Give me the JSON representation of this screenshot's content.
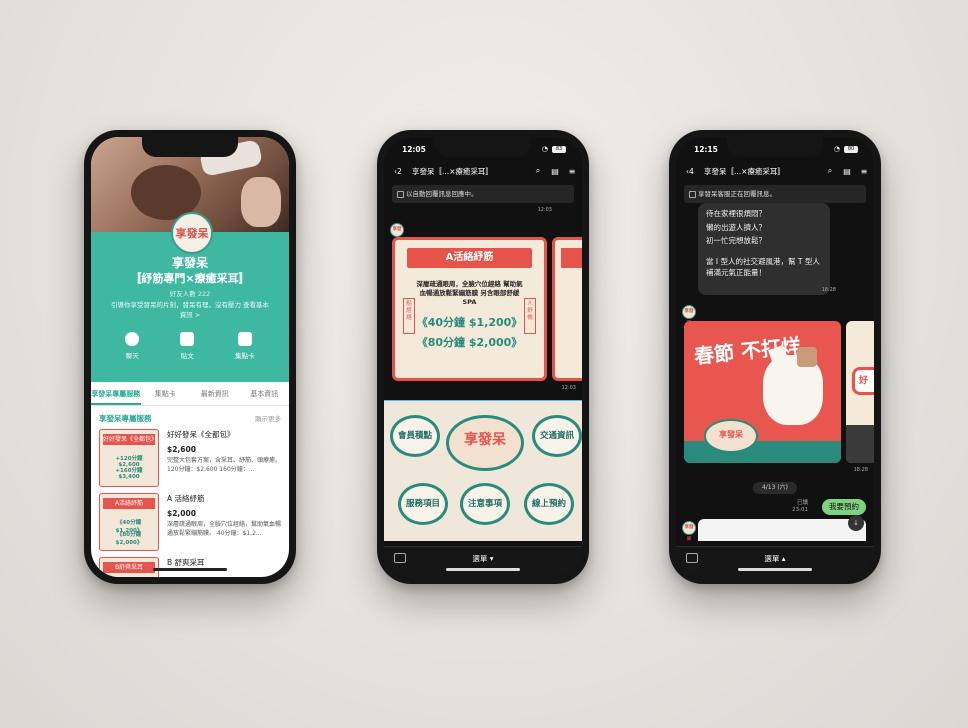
{
  "phone1": {
    "logo_text": "享發呆",
    "account_name": "享發呆",
    "subtitle": "〚紓筋專門×療癒采耳〛",
    "friends": "好友人數 222",
    "description": "引導你享受發呆的片刻，發呆有理，沒有壓力 查看基本資訊 >",
    "actions": [
      "聊天",
      "貼文",
      "集點卡"
    ],
    "tabs": [
      "享發呆專屬服務",
      "集點卡",
      "最新資訊",
      "基本資訊"
    ],
    "section_title": "享發呆專屬服務",
    "show_more": "顯示更多",
    "products": [
      {
        "thumb_title": "好好發呆《全都包》",
        "thumb_l1": "+120分鐘 $2,600",
        "thumb_l2": "+160分鐘 $3,400",
        "name": "好好發呆《全都包》",
        "price": "$2,600",
        "desc": "完整大包套方案，含采耳、紓筋、頭療癒。 120分鐘：$2,600 160分鐘：..."
      },
      {
        "thumb_title": "A活絡紓筋",
        "thumb_l1": "《40分鐘 $1,200》",
        "thumb_l2": "《80分鐘 $2,000》",
        "name": "A 活絡紓筋",
        "price": "$2,000",
        "desc": "深層疏通眼周，全臉穴位經絡，幫助氣血暢通放鬆緊繃筋膜。 40分鐘：$1,2..."
      },
      {
        "thumb_title": "B舒爽采耳",
        "thumb_l1": "",
        "thumb_l2": "",
        "name": "B 舒爽采耳",
        "price": "",
        "desc": ""
      }
    ]
  },
  "phone2": {
    "time": "12:05",
    "battery": "83",
    "back_count": "2",
    "title": "享發呆〚...×療癒采耳〛",
    "notice": "以自動回覆訊息回應中。",
    "card": {
      "banner": "A活絡紓筋",
      "body": "深層疏通眼周，全臉穴位經絡 幫助氣血暢通放鬆緊繃筋膜 另含眼部舒緩SPA",
      "price1": "《40分鐘 $1,200》",
      "price2": "《80分鐘 $2,000》",
      "side_left": "點經絡",
      "side_right": "人舒暢",
      "time_top": "12:03",
      "time_bottom": "12:03"
    },
    "rich_menu": {
      "center": "享發呆",
      "items": [
        "會員積點",
        "交通資訊",
        "服務項目",
        "注意事項",
        "線上預約"
      ]
    },
    "menu_label": "選單 ▾"
  },
  "phone3": {
    "time": "12:15",
    "battery": "80",
    "back_count": "4",
    "title": "享發呆〚...×療癒采耳〛",
    "notice": "享發呆客服正在回覆訊息。",
    "bubble_lines": [
      "待在家裡很煩悶？",
      "懶的出遊人擠人？",
      "初一忙完想放鬆？",
      "",
      "當 I 型人的社交避風港，幫 T 型人補滿元氣正能量！"
    ],
    "bubble_time": "18:28",
    "card": {
      "headline": "春節 不打烊",
      "logo": "享發呆",
      "time": "18:28",
      "side_text": "好"
    },
    "date": "4/13 (六)",
    "read": "已讀",
    "read_time": "23:01",
    "my_message": "我要預約",
    "menu_label": "選單 ▴"
  },
  "colors": {
    "teal": "#3fb8a2",
    "red": "#e5534b",
    "cream": "#f4ead9",
    "dark": "#111111"
  }
}
